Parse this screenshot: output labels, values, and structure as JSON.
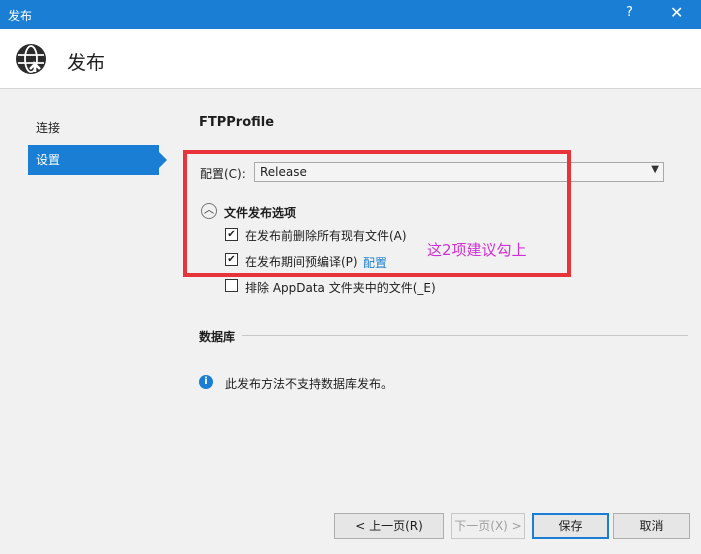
{
  "window": {
    "title": "发布",
    "help_label": "?",
    "close_label": "✕"
  },
  "header": {
    "icon": "globe-publish-icon",
    "title": "发布"
  },
  "sidebar": {
    "items": [
      {
        "label": "连接",
        "selected": false
      },
      {
        "label": "设置",
        "selected": true
      }
    ]
  },
  "settings": {
    "profile_name": "FTPProfile",
    "config_label": "配置(C):",
    "config_value": "Release",
    "file_publish_options_title": "文件发布选项",
    "options": [
      {
        "label": "在发布前删除所有现有文件(A)",
        "checked": true
      },
      {
        "label": "在发布期间预编译(P)",
        "checked": true,
        "link": "配置"
      },
      {
        "label": "排除 AppData 文件夹中的文件(_E)",
        "checked": false
      }
    ],
    "annotation": "这2项建议勾上"
  },
  "database": {
    "title": "数据库",
    "info_text": "此发布方法不支持数据库发布。"
  },
  "buttons": {
    "prev": "< 上一页(R)",
    "next": "下一页(X) >",
    "save": "保存",
    "cancel": "取消"
  },
  "colors": {
    "accent": "#1a7fd4",
    "annotation_box": "#e8333a",
    "annotation_text": "#d12fd6"
  }
}
